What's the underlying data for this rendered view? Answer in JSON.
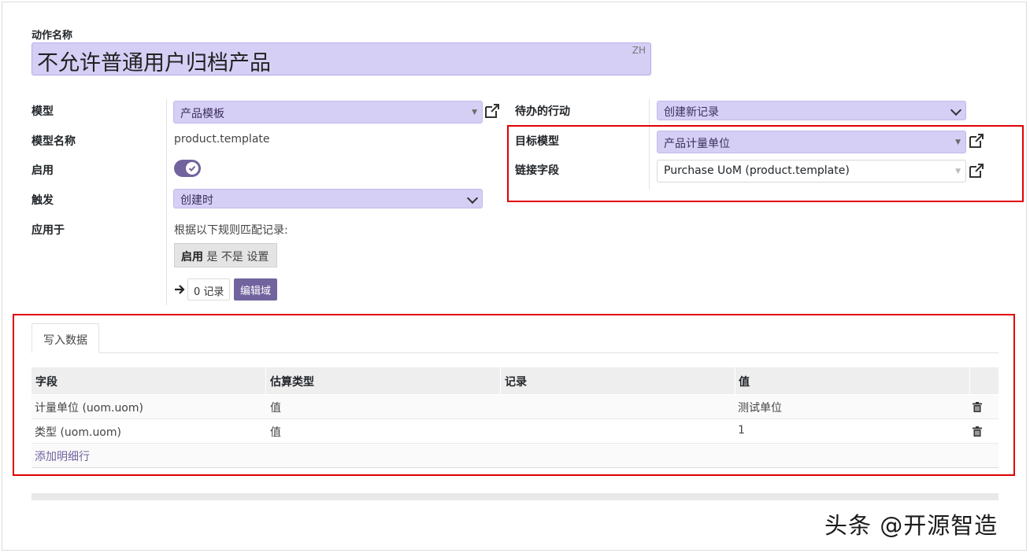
{
  "action": {
    "name_label": "动作名称",
    "name_value": "不允许普通用户归档产品",
    "lang_badge": "ZH"
  },
  "left": {
    "model_label": "模型",
    "model_value": "产品模板",
    "model_name_label": "模型名称",
    "model_name_value": "product.template",
    "active_label": "启用",
    "trigger_label": "触发",
    "trigger_value": "创建时",
    "apply_label": "应用于",
    "apply_desc": "根据以下规则匹配记录:",
    "domain_tag_bold": "启用",
    "domain_tag_rest": "是 不是 设置",
    "records_button": "0 记录",
    "edit_domain_button": "编辑域"
  },
  "right": {
    "todo_label": "待办的行动",
    "todo_value": "创建新记录",
    "target_model_label": "目标模型",
    "target_model_value": "产品计量单位",
    "link_field_label": "链接字段",
    "link_field_value": "Purchase UoM (product.template)"
  },
  "notebook": {
    "tab_label": "写入数据",
    "columns": [
      "字段",
      "估算类型",
      "记录",
      "值"
    ],
    "rows": [
      {
        "field": "计量单位 (uom.uom)",
        "type": "值",
        "record": "",
        "value": "测试单位"
      },
      {
        "field": "类型 (uom.uom)",
        "type": "值",
        "record": "",
        "value": "1"
      }
    ],
    "add_line": "添加明细行"
  },
  "watermark": "头条 @开源智造",
  "colors": {
    "accent": "#71639e",
    "field_bg": "#d6cff5",
    "highlight_box": "#e00000"
  }
}
